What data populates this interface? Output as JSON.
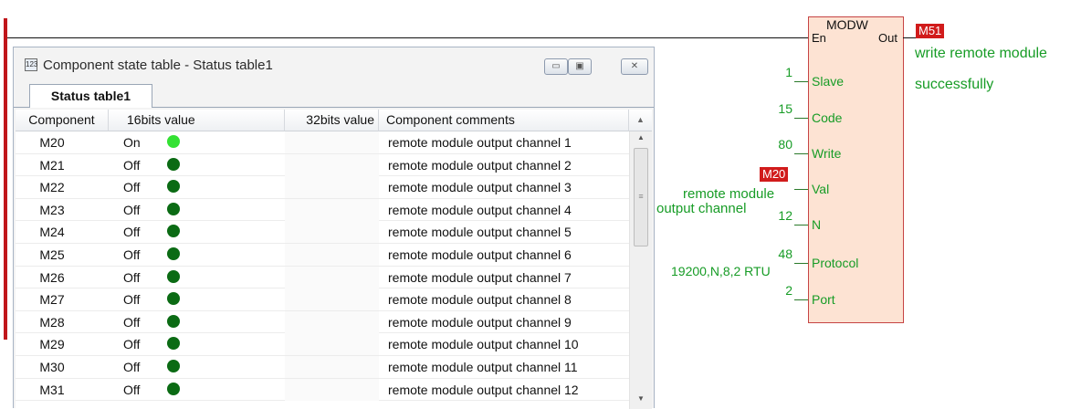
{
  "window": {
    "title": "Component state table - Status table1",
    "tab": "Status table1",
    "buttons": {
      "minimize": "▭",
      "maximize": "▣",
      "close": "✕"
    }
  },
  "table": {
    "headers": [
      "Component",
      "16bits value",
      "32bits value",
      "Component comments"
    ],
    "rows": [
      {
        "component": "M20",
        "value": "On",
        "state": "on",
        "comment": "remote module output channel 1"
      },
      {
        "component": "M21",
        "value": "Off",
        "state": "off",
        "comment": "remote module output channel 2"
      },
      {
        "component": "M22",
        "value": "Off",
        "state": "off",
        "comment": "remote module output channel 3"
      },
      {
        "component": "M23",
        "value": "Off",
        "state": "off",
        "comment": "remote module output channel 4"
      },
      {
        "component": "M24",
        "value": "Off",
        "state": "off",
        "comment": "remote module output channel 5"
      },
      {
        "component": "M25",
        "value": "Off",
        "state": "off",
        "comment": "remote module output channel 6"
      },
      {
        "component": "M26",
        "value": "Off",
        "state": "off",
        "comment": "remote module output channel 7"
      },
      {
        "component": "M27",
        "value": "Off",
        "state": "off",
        "comment": "remote module output channel 8"
      },
      {
        "component": "M28",
        "value": "Off",
        "state": "off",
        "comment": "remote module output channel 9"
      },
      {
        "component": "M29",
        "value": "Off",
        "state": "off",
        "comment": "remote module output channel 10"
      },
      {
        "component": "M30",
        "value": "Off",
        "state": "off",
        "comment": "remote module output channel 11"
      },
      {
        "component": "M31",
        "value": "Off",
        "state": "off",
        "comment": "remote module output channel 12"
      }
    ]
  },
  "block": {
    "name": "MODW",
    "en": "En",
    "out": "Out",
    "out_coil": "M51",
    "out_comment_1": "write remote module",
    "out_comment_2": "successfully",
    "pins": [
      {
        "label": "Slave",
        "value": "1"
      },
      {
        "label": "Code",
        "value": "15"
      },
      {
        "label": "Write",
        "value": "80"
      },
      {
        "label": "Val",
        "value": "M20"
      },
      {
        "label": "N",
        "value": "12"
      },
      {
        "label": "Protocol",
        "value": "48"
      },
      {
        "label": "Port",
        "value": "2"
      }
    ],
    "val_comment_1": "remote module",
    "val_comment_2": "output channel",
    "protocol_comment": "19200,N,8,2 RTU"
  },
  "colors": {
    "rail": "#c0161b",
    "led_on": "#33e133",
    "led_off": "#0b6b14",
    "block_fill": "#fde3d3",
    "annotation": "#179c26"
  }
}
